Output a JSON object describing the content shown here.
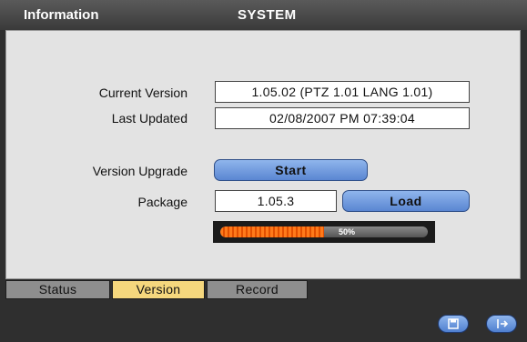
{
  "header": {
    "left_title": "Information",
    "center_title": "SYSTEM"
  },
  "version_info": {
    "current_version_label": "Current Version",
    "current_version_value": "1.05.02 (PTZ 1.01 LANG 1.01)",
    "last_updated_label": "Last Updated",
    "last_updated_value": "02/08/2007 PM 07:39:04"
  },
  "upgrade": {
    "label": "Version Upgrade",
    "start_button": "Start",
    "package_label": "Package",
    "package_value": "1.05.3",
    "load_button": "Load",
    "progress_percent": 50,
    "progress_text": "50%"
  },
  "tabs": [
    {
      "label": "Status",
      "active": false
    },
    {
      "label": "Version",
      "active": true
    },
    {
      "label": "Record",
      "active": false
    }
  ],
  "colors": {
    "button_blue": "#6f9be0",
    "active_tab": "#f5d77d",
    "inactive_tab": "#8e8e8e",
    "progress_orange": "#ff7a1a"
  },
  "bottom_buttons": [
    {
      "icon": "save-icon"
    },
    {
      "icon": "exit-icon"
    }
  ]
}
